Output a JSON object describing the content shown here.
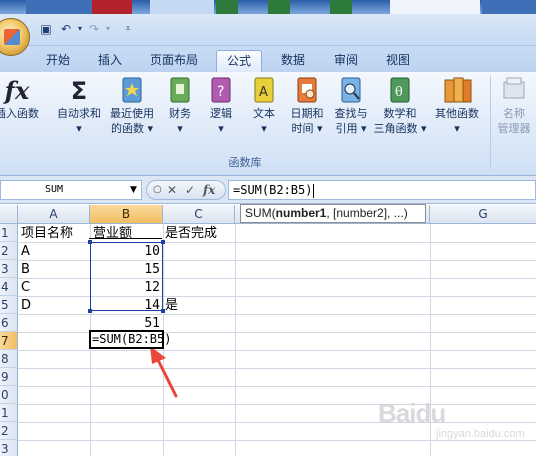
{
  "qat": {
    "undo_icon": "undo-icon",
    "redo_icon": "redo-icon",
    "save_icon": "save-icon"
  },
  "tabs": [
    {
      "label": "开始"
    },
    {
      "label": "插入"
    },
    {
      "label": "页面布局"
    },
    {
      "label": "公式",
      "active": true
    },
    {
      "label": "数据"
    },
    {
      "label": "审阅"
    },
    {
      "label": "视图"
    }
  ],
  "ribbon": {
    "buttons": [
      {
        "label1": "插入函数",
        "label2": "",
        "icon": "fx-icon"
      },
      {
        "label1": "自动求和",
        "label2": "▾",
        "icon": "sigma-icon"
      },
      {
        "label1": "最近使用",
        "label2": "的函数 ▾",
        "icon": "recent-book-icon"
      },
      {
        "label1": "财务",
        "label2": "▾",
        "icon": "finance-book-icon"
      },
      {
        "label1": "逻辑",
        "label2": "▾",
        "icon": "logic-book-icon"
      },
      {
        "label1": "文本",
        "label2": "▾",
        "icon": "text-book-icon"
      },
      {
        "label1": "日期和",
        "label2": "时间 ▾",
        "icon": "date-book-icon"
      },
      {
        "label1": "查找与",
        "label2": "引用 ▾",
        "icon": "lookup-book-icon"
      },
      {
        "label1": "数学和",
        "label2": "三角函数 ▾",
        "icon": "math-book-icon"
      },
      {
        "label1": "其他函数",
        "label2": "▾",
        "icon": "more-books-icon"
      },
      {
        "label1": "名称",
        "label2": "管理器",
        "icon": "name-manager-icon"
      }
    ],
    "group_label": "函数库"
  },
  "formula_bar": {
    "name_box": "SUM",
    "cancel_glyph": "✕",
    "enter_glyph": "✓",
    "fx_glyph": "fx",
    "formula": "=SUM(B2:B5)"
  },
  "tooltip": {
    "func": "SUM(",
    "arg1": "number1",
    "rest": ", [number2], ...)"
  },
  "grid": {
    "columns": [
      "A",
      "B",
      "C",
      "",
      "",
      "",
      "G"
    ],
    "rows": [
      "1",
      "2",
      "3",
      "4",
      "5",
      "6",
      "7",
      "8",
      "9",
      "0",
      "1",
      "2",
      "3"
    ],
    "cells": {
      "A1": "项目名称",
      "B1": "营业额",
      "C1": "是否完成",
      "A2": "A",
      "B2": "10",
      "A3": "B",
      "B3": "15",
      "A4": "C",
      "B4": "12",
      "A5": "D",
      "B5": "14",
      "C5": "是",
      "B6": "51",
      "B7": "=SUM(B2:B5)"
    }
  },
  "colors": {
    "accent": "#f1be62",
    "selection": "#1f3fa3",
    "arrow": "#e8483a"
  },
  "watermark": {
    "main": "Baidu",
    "sub": "jingyan.baidu.com"
  }
}
